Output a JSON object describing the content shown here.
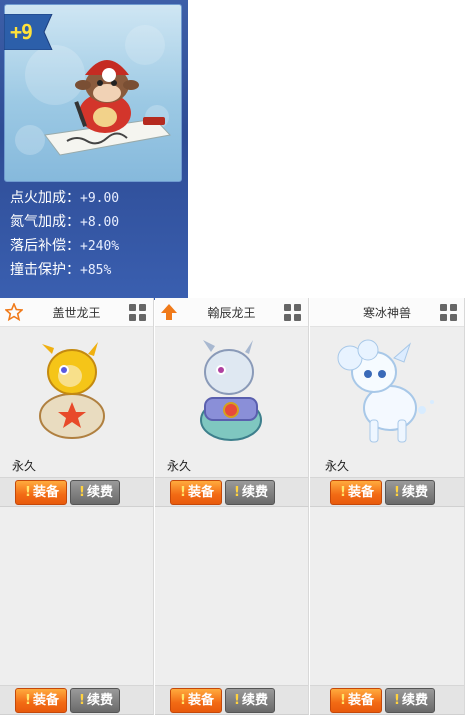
{
  "pet_card": {
    "level_badge": "+9",
    "stats": [
      {
        "label": "点火加成：",
        "value": "+9.00"
      },
      {
        "label": "氮气加成：",
        "value": "+8.00"
      },
      {
        "label": "落后补偿：",
        "value": "+240%"
      },
      {
        "label": "撞击保护：",
        "value": "+85%"
      }
    ]
  },
  "items": [
    {
      "name": "盖世龙王",
      "duration": "永久",
      "corner_icon": "star-icon",
      "equip_label": "装备",
      "renew_label": "续费"
    },
    {
      "name": "翰辰龙王",
      "duration": "永久",
      "corner_icon": "arrow-up-icon",
      "equip_label": "装备",
      "renew_label": "续费"
    },
    {
      "name": "寒冰神兽",
      "duration": "永久",
      "corner_icon": "",
      "equip_label": "装备",
      "renew_label": "续费"
    },
    {
      "name": "",
      "duration": "",
      "corner_icon": "",
      "equip_label": "装备",
      "renew_label": "续费"
    },
    {
      "name": "",
      "duration": "",
      "corner_icon": "",
      "equip_label": "装备",
      "renew_label": "续费"
    },
    {
      "name": "",
      "duration": "",
      "corner_icon": "",
      "equip_label": "装备",
      "renew_label": "续费"
    }
  ],
  "colors": {
    "equip": "#f26a14",
    "renew": "#6a6a6a",
    "card_bg": "#eeeeee",
    "panel": "#2e4c95"
  }
}
